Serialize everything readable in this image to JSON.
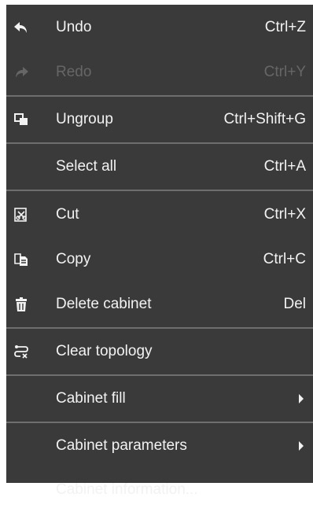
{
  "menu": {
    "items": [
      {
        "label": "Undo",
        "shortcut": "Ctrl+Z",
        "icon": "undo-icon",
        "enabled": true
      },
      {
        "label": "Redo",
        "shortcut": "Ctrl+Y",
        "icon": "redo-icon",
        "enabled": false
      },
      {
        "label": "Ungroup",
        "shortcut": "Ctrl+Shift+G",
        "icon": "ungroup-icon",
        "enabled": true
      },
      {
        "label": "Select all",
        "shortcut": "Ctrl+A",
        "icon": "",
        "enabled": true
      },
      {
        "label": "Cut",
        "shortcut": "Ctrl+X",
        "icon": "cut-icon",
        "enabled": true
      },
      {
        "label": "Copy",
        "shortcut": "Ctrl+C",
        "icon": "copy-icon",
        "enabled": true
      },
      {
        "label": "Delete cabinet",
        "shortcut": "Del",
        "icon": "trash-icon",
        "enabled": true
      },
      {
        "label": "Clear topology",
        "shortcut": "",
        "icon": "clear-topology-icon",
        "enabled": true
      },
      {
        "label": "Cabinet fill",
        "shortcut": "",
        "icon": "",
        "submenu": true,
        "enabled": true
      },
      {
        "label": "Cabinet parameters",
        "shortcut": "",
        "icon": "",
        "submenu": true,
        "enabled": true
      },
      {
        "label": "Cabinet information...",
        "shortcut": "",
        "icon": "",
        "enabled": true
      }
    ]
  },
  "colors": {
    "background": "#3a3a3a",
    "text": "#f2f2f2",
    "disabled_text": "#666666",
    "separator": "#6e6e6e"
  }
}
